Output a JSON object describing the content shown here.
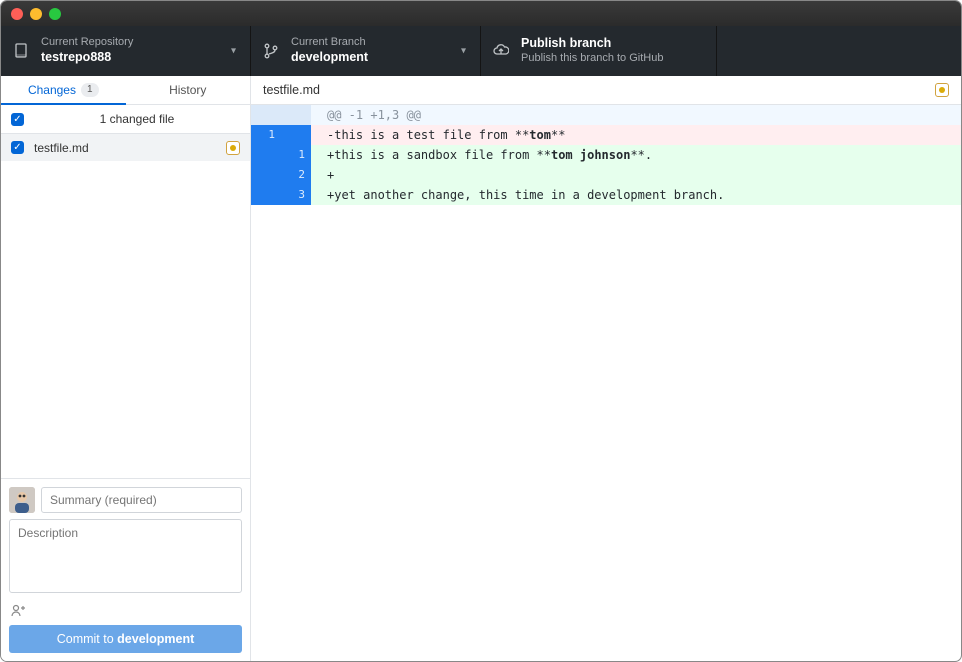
{
  "toolbar": {
    "repo": {
      "label": "Current Repository",
      "value": "testrepo888"
    },
    "branch": {
      "label": "Current Branch",
      "value": "development"
    },
    "publish": {
      "label": "Publish branch",
      "value": "Publish this branch to GitHub"
    }
  },
  "tabs": {
    "changes": "Changes",
    "changes_count": "1",
    "history": "History"
  },
  "files": {
    "summary": "1 changed file",
    "items": [
      {
        "name": "testfile.md",
        "status": "modified",
        "checked": true
      }
    ]
  },
  "commit": {
    "summary_placeholder": "Summary (required)",
    "description_placeholder": "Description",
    "button_prefix": "Commit to ",
    "button_branch": "development"
  },
  "diff": {
    "file": "testfile.md",
    "hunk_header": "@@ -1 +1,3 @@",
    "lines": [
      {
        "type": "del",
        "old": "1",
        "new": "",
        "text": "-this is a test file from **tom**"
      },
      {
        "type": "add",
        "old": "",
        "new": "1",
        "text": "+this is a sandbox file from **tom johnson**."
      },
      {
        "type": "add",
        "old": "",
        "new": "2",
        "text": "+"
      },
      {
        "type": "add",
        "old": "",
        "new": "3",
        "text": "+yet another change, this time in a development branch."
      }
    ]
  }
}
